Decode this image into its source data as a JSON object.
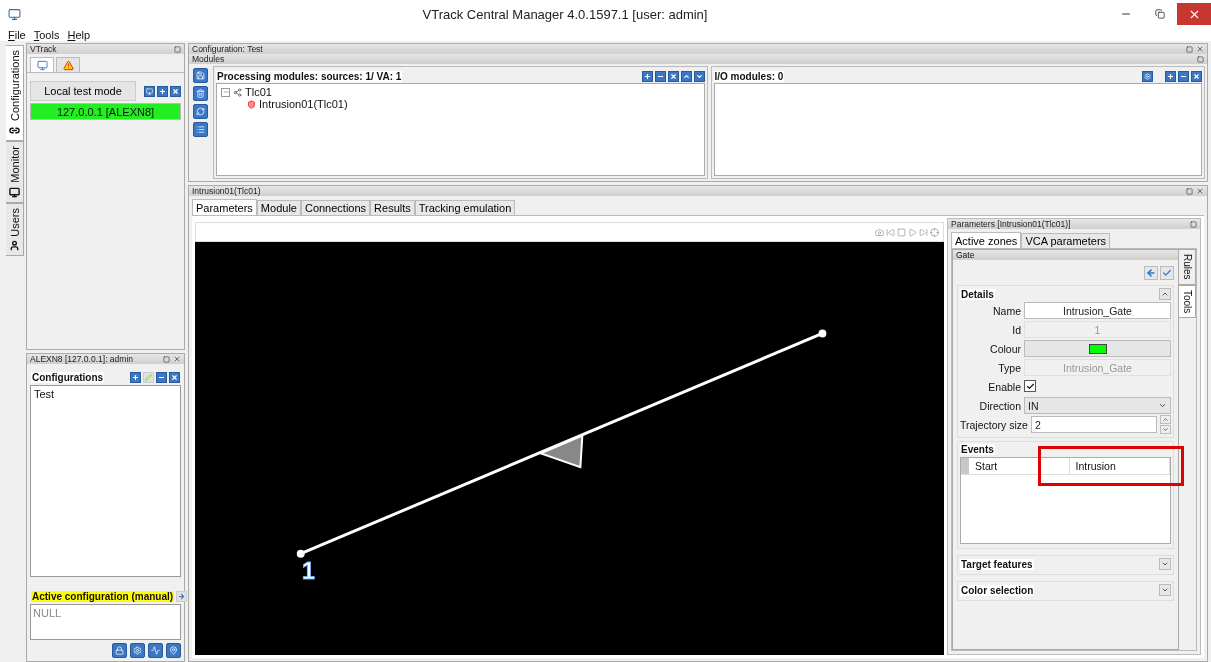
{
  "window": {
    "title": "VTrack Central Manager 4.0.1597.1 [user: admin]"
  },
  "menu": [
    {
      "label": "File"
    },
    {
      "label": "Tools"
    },
    {
      "label": "Help"
    }
  ],
  "side_tabs": [
    {
      "label": "Configurations",
      "kind": "link",
      "selected": true
    },
    {
      "label": "Monitor",
      "kind": "monitor",
      "selected": false
    },
    {
      "label": "Users",
      "kind": "user",
      "selected": false
    }
  ],
  "vtrack_panel": {
    "title": "VTrack",
    "tabs": [
      {
        "kind": "monitor",
        "selected": true
      },
      {
        "kind": "warning",
        "selected": false
      }
    ],
    "mode_button": "Local test mode",
    "servers": [
      {
        "label": "127.0.0.1 [ALEXN8]",
        "connected": true
      }
    ]
  },
  "session_panel": {
    "title": "ALEXN8 [127.0.0.1]: admin",
    "configurations": {
      "title": "Configurations",
      "items": [
        {
          "label": "Test",
          "selected": false
        }
      ]
    },
    "active_configuration": {
      "title": "Active configuration (manual)",
      "value": "NULL"
    }
  },
  "configuration": {
    "title": "Configuration: Test",
    "modules_title": "Modules",
    "processing": {
      "title": "Processing modules: sources: 1/ VA: 1",
      "tree": [
        {
          "label": "Tlc01",
          "kind": "source",
          "expanded": true,
          "children": [
            {
              "label": "Intrusion01(Tlc01)",
              "kind": "module"
            }
          ]
        }
      ]
    },
    "io": {
      "title": "I/O modules: 0"
    }
  },
  "module_panel": {
    "title": "Intrusion01(Tlc01)",
    "tabs": [
      {
        "label": "Parameters",
        "selected": true
      },
      {
        "label": "Module",
        "selected": false
      },
      {
        "label": "Connections",
        "selected": false
      },
      {
        "label": "Results",
        "selected": false
      },
      {
        "label": "Tracking emulation",
        "selected": false
      }
    ],
    "video": {
      "zone_label": "1"
    },
    "parameters": {
      "title": "Parameters [Intrusion01(Tlc01)]",
      "tabs": [
        {
          "label": "Active zones",
          "selected": true
        },
        {
          "label": "VCA parameters",
          "selected": false
        }
      ],
      "zone_title": "Gate",
      "side_tabs": [
        {
          "label": "Rules",
          "selected": true
        },
        {
          "label": "Tools",
          "selected": false
        }
      ],
      "details": {
        "title": "Details",
        "expanded": true,
        "fields": [
          {
            "label": "Name",
            "kind": "text",
            "value": "Intrusion_Gate"
          },
          {
            "label": "Id",
            "kind": "readonly",
            "value": "1"
          },
          {
            "label": "Colour",
            "kind": "color",
            "color": "#00ff00"
          },
          {
            "label": "Type",
            "kind": "readonly",
            "value": "Intrusion_Gate"
          },
          {
            "label": "Enable",
            "kind": "checkbox",
            "checked": true
          },
          {
            "label": "Direction",
            "kind": "select",
            "value": "IN"
          },
          {
            "label": "Trajectory size",
            "kind": "spin",
            "value": "2"
          }
        ]
      },
      "events": {
        "title": "Events",
        "rows": [
          {
            "column_1": "Start",
            "column_2": "Intrusion",
            "highlighted": true
          }
        ]
      },
      "sections": [
        {
          "title": "Target features",
          "expanded": false
        },
        {
          "title": "Color selection",
          "expanded": false
        }
      ]
    }
  }
}
